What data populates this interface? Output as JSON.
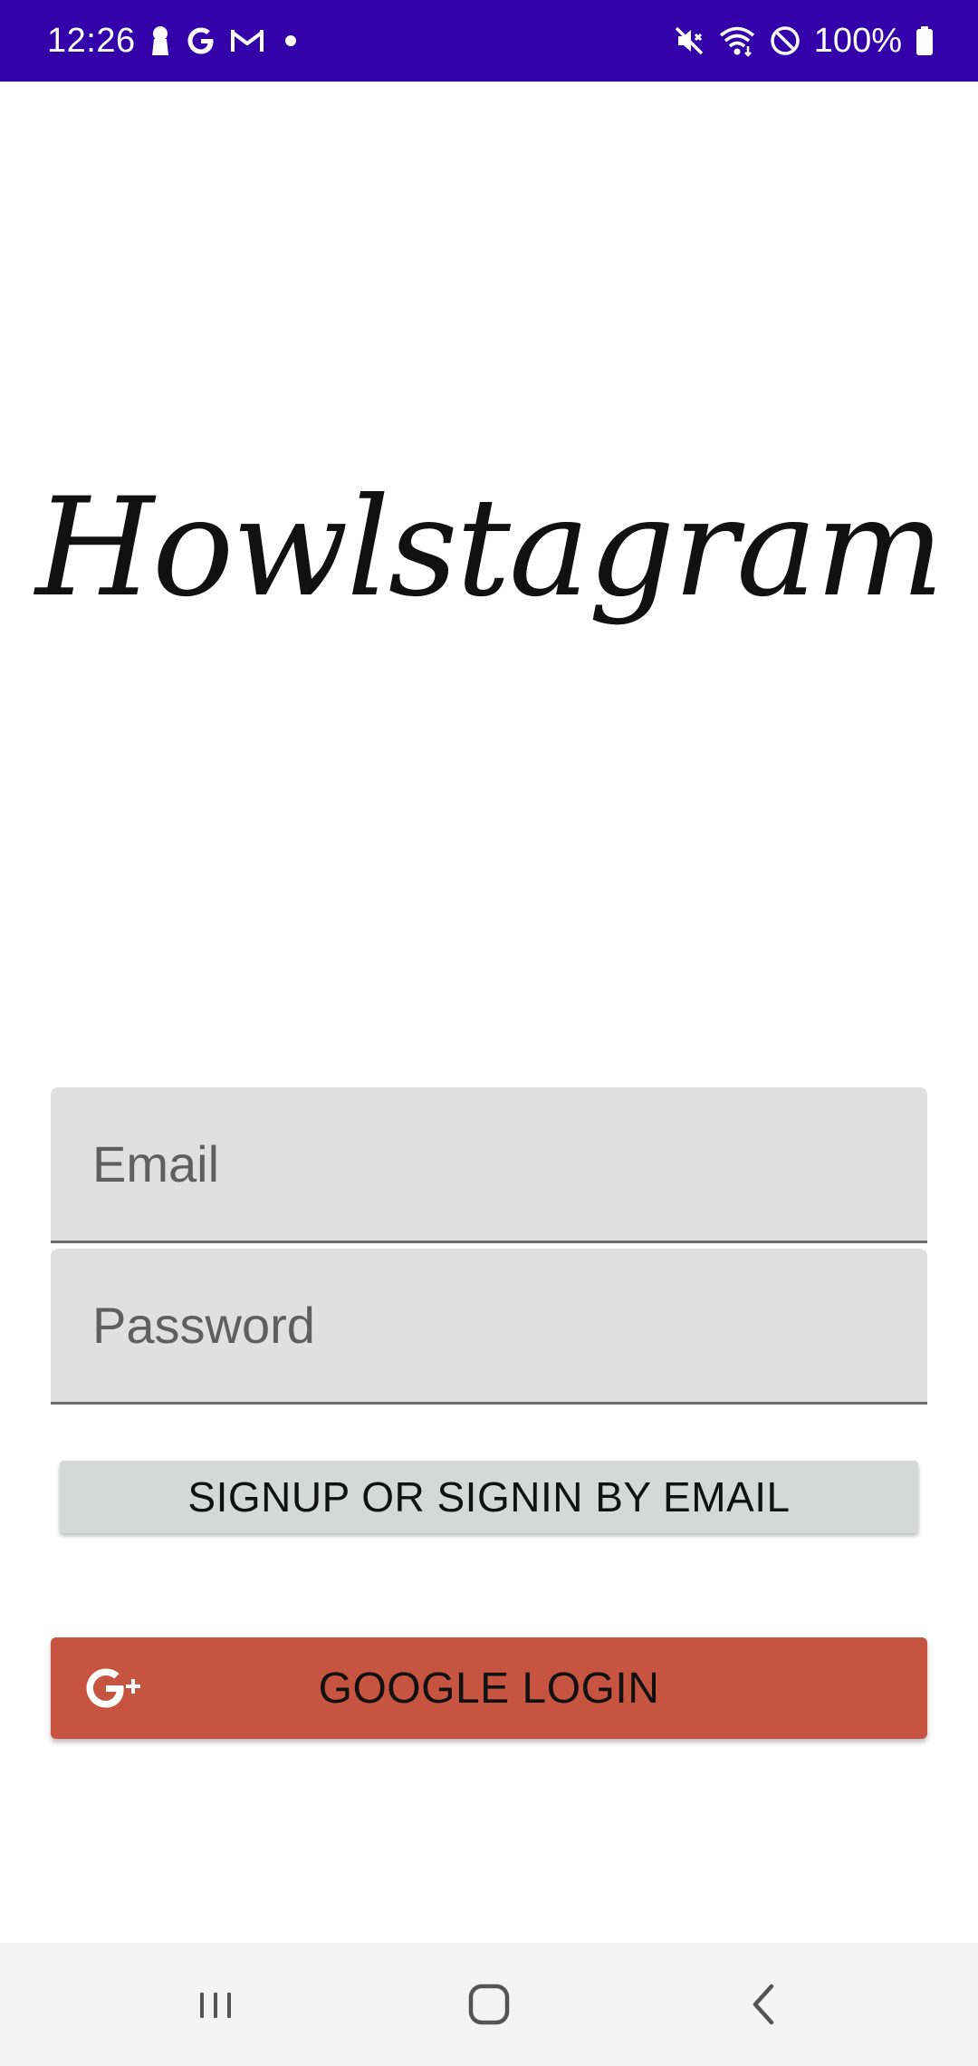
{
  "status_bar": {
    "time": "12:26",
    "battery": "100%",
    "left_icons": [
      "keyhole-icon",
      "google-g-icon",
      "gmail-icon",
      "notification-dot-icon"
    ],
    "right_icons": [
      "mute-icon",
      "wifi-icon",
      "do-not-disturb-icon",
      "battery-icon"
    ],
    "background": "#3300aa"
  },
  "logo": {
    "text": "Howlstagram"
  },
  "form": {
    "email_placeholder": "Email",
    "password_placeholder": "Password",
    "email_button_label": "SIGNUP OR SIGNIN BY EMAIL",
    "google_button_label": "GOOGLE LOGIN",
    "google_button_color": "#c65440",
    "google_icon": "google-plus-icon"
  },
  "nav_bar": {
    "buttons": [
      "recents-icon",
      "home-icon",
      "back-icon"
    ]
  }
}
